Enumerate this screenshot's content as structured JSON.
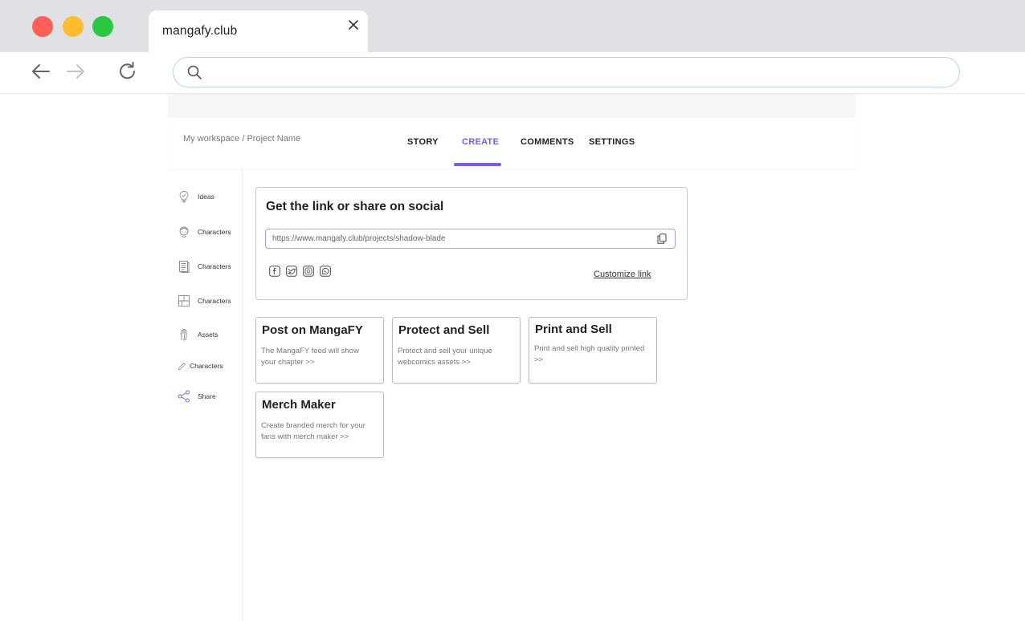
{
  "browser": {
    "tab_title": "mangafy.club",
    "address_value": ""
  },
  "header": {
    "breadcrumb": "My workspace / Project Name",
    "tabs": [
      {
        "label": "STORY",
        "active": false
      },
      {
        "label": "CREATE",
        "active": true
      },
      {
        "label": "COMMENTS",
        "active": false
      },
      {
        "label": "SETTINGS",
        "active": false
      }
    ],
    "accent_color": "#7a5af0"
  },
  "sidebar": {
    "items": [
      {
        "label": "Ideas",
        "icon": "lightbulb-icon"
      },
      {
        "label": "Characters",
        "icon": "character-head-icon"
      },
      {
        "label": "Characters",
        "icon": "document-page-icon"
      },
      {
        "label": "Characters",
        "icon": "panel-layout-icon"
      },
      {
        "label": "Assets",
        "icon": "hand-assets-icon"
      },
      {
        "label": "Characters",
        "icon": "pencil-icon"
      },
      {
        "label": "Share",
        "icon": "share-icon"
      }
    ]
  },
  "share": {
    "title": "Get the link or share on social",
    "link_value": "https://www.mangafy.club/projects/shadow-blade",
    "customize_label": "Customize link",
    "socials": [
      "facebook-icon",
      "twitter-icon",
      "instagram-icon",
      "whatsapp-icon"
    ]
  },
  "cards": [
    {
      "title": "Post on MangaFY",
      "desc": "The MangaFY feed will show your chapter >>"
    },
    {
      "title": "Protect and Sell",
      "desc": "Protect and sell your unique webcomics assets >>"
    },
    {
      "title": "Print and Sell",
      "desc": "Print and sell high quality printed >>"
    },
    {
      "title": "Merch Maker",
      "desc": "Create branded merch for your fans with merch maker >>"
    }
  ]
}
